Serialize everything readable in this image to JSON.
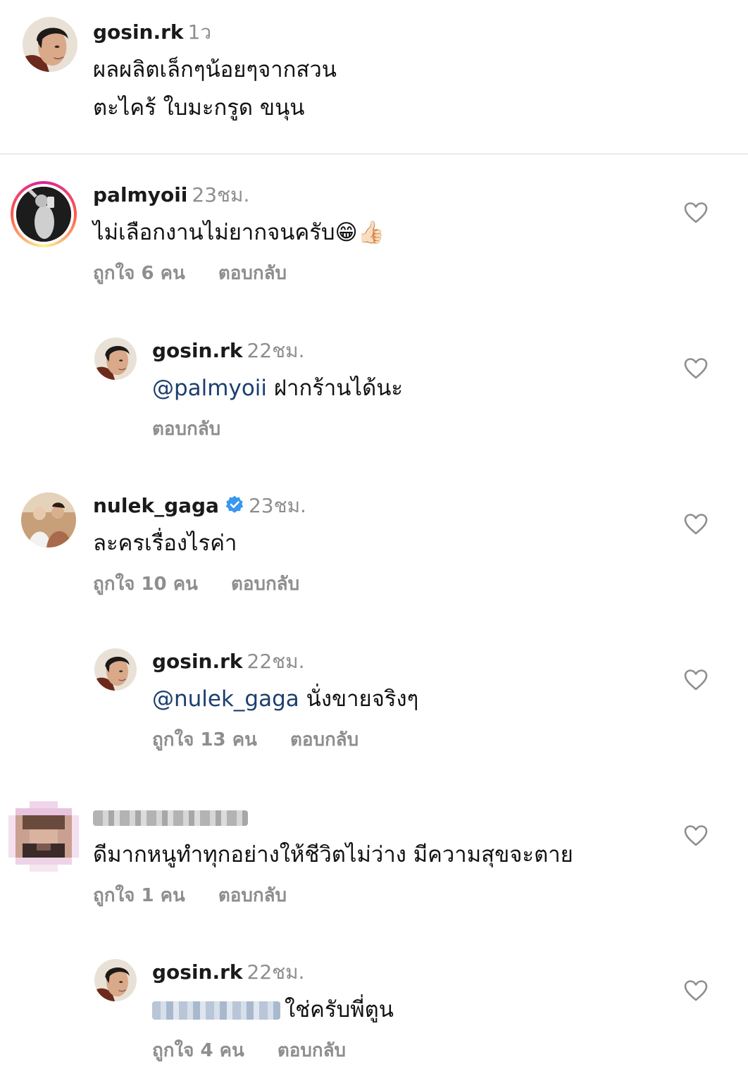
{
  "icons": {
    "heart": "heart-outline-icon",
    "verified": "verified-badge-icon"
  },
  "colors": {
    "username": "#1a1a1a",
    "meta": "#8e8e8e",
    "mention": "#1c3f6e",
    "verified": "#3897f0",
    "divider": "#dbdbdb"
  },
  "caption": {
    "username": "gosin.rk",
    "time": "1ว",
    "line1": "ผลผลิตเล็กๆน้อยๆจากสวน",
    "line2": "ตะไคร้ ใบมะกรูด ขนุน"
  },
  "comments": [
    {
      "username": "palmyoii",
      "time": "23ชม.",
      "text": "ไม่เลือกงานไม่ยากจนครับ😁👍🏻",
      "likes": "ถูกใจ 6 คน",
      "reply_label": "ตอบกลับ"
    },
    {
      "username": "gosin.rk",
      "time": "22ชม.",
      "mention": "@palmyoii",
      "text": " ฝากร้านได้นะ",
      "reply_label": "ตอบกลับ"
    },
    {
      "username": "nulek_gaga",
      "time": "23ชม.",
      "text": "ละครเรื่องไรค่า",
      "likes": "ถูกใจ 10 คน",
      "reply_label": "ตอบกลับ"
    },
    {
      "username": "gosin.rk",
      "time": "22ชม.",
      "mention": "@nulek_gaga",
      "text": " นั่งขายจริงๆ",
      "likes": "ถูกใจ 13 คน",
      "reply_label": "ตอบกลับ"
    },
    {
      "text": "ดีมากหนูทำทุกอย่างให้ชีวิตไม่ว่าง มีความสุขจะตาย",
      "likes": "ถูกใจ 1 คน",
      "reply_label": "ตอบกลับ"
    },
    {
      "username": "gosin.rk",
      "time": "22ชม.",
      "text": "ใช่ครับพี่ตูน",
      "likes": "ถูกใจ 4 คน",
      "reply_label": "ตอบกลับ"
    }
  ]
}
